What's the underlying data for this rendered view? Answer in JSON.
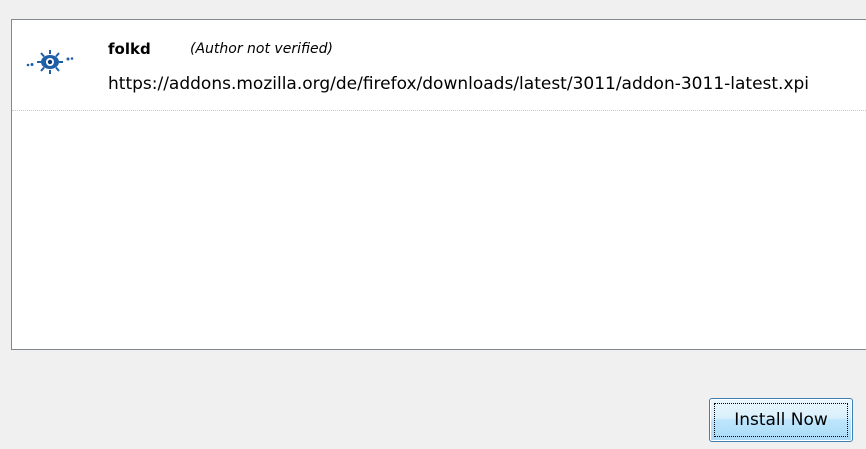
{
  "addon": {
    "name": "folkd",
    "status": "(Author not verified)",
    "url": "https://addons.mozilla.org/de/firefox/downloads/latest/3011/addon-3011-latest.xpi",
    "icon": "folkd-eye-icon",
    "icon_color": "#1f5ea8"
  },
  "buttons": {
    "install_now": "Install Now"
  },
  "colors": {
    "dialog_background": "#f0f0f0",
    "list_background": "#ffffff",
    "list_border": "#828790",
    "button_border": "#3c7fb1"
  }
}
